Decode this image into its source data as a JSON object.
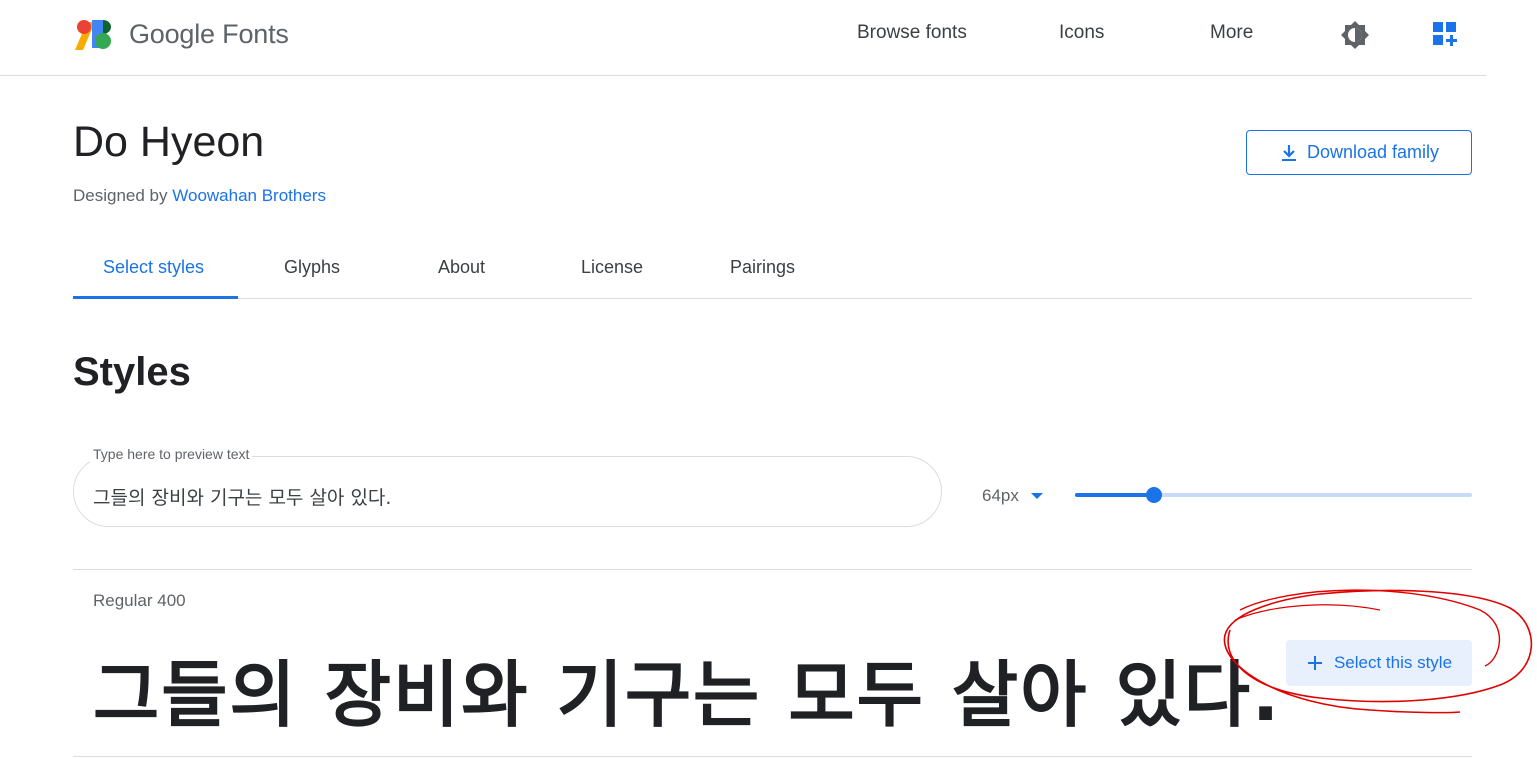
{
  "header": {
    "logo_text": "Google Fonts",
    "nav": [
      "Browse fonts",
      "Icons",
      "More"
    ]
  },
  "family": {
    "name": "Do Hyeon",
    "designed_by_label": "Designed by",
    "designer": "Woowahan Brothers",
    "download_label": "Download family"
  },
  "tabs": [
    "Select styles",
    "Glyphs",
    "About",
    "License",
    "Pairings"
  ],
  "styles": {
    "heading": "Styles",
    "preview_label": "Type here to preview text",
    "preview_text": "그들의 장비와 기구는 모두 살아 있다.",
    "size_value": "64px",
    "slider_fraction": 0.2,
    "items": [
      {
        "name": "Regular 400",
        "sample": "그들의 장비와 기구는 모두 살아 있다.",
        "action_label": "Select this style"
      }
    ]
  },
  "colors": {
    "accent": "#1a73e8",
    "annotation": "#e00000"
  },
  "icons": {
    "theme": "brightness-icon",
    "apps": "apps-add-icon",
    "download": "download-icon",
    "add": "plus-icon"
  }
}
